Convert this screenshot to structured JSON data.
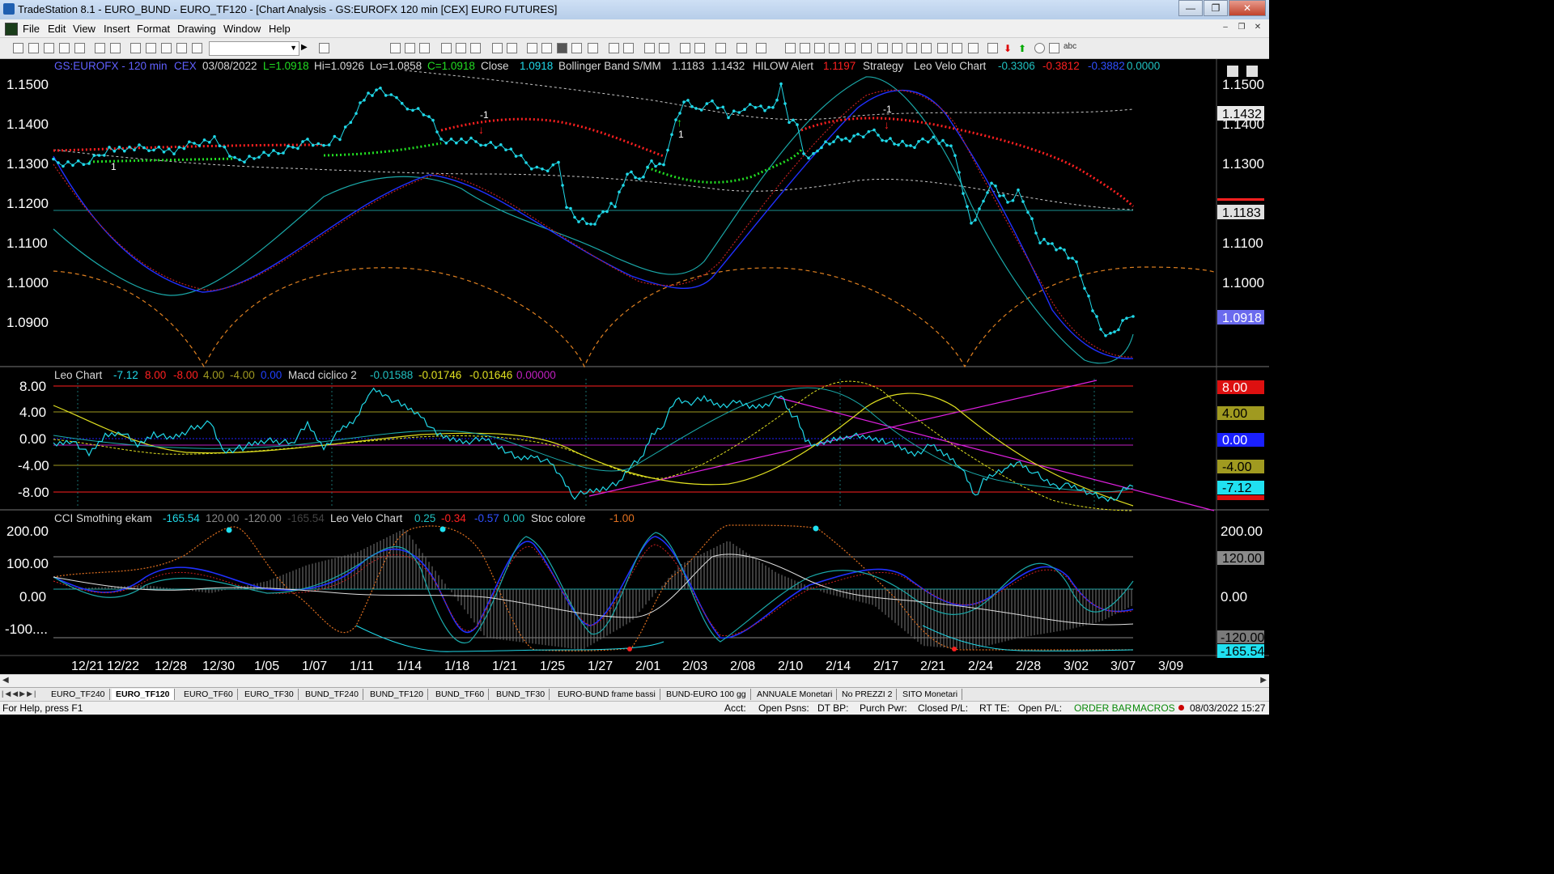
{
  "window": {
    "title": "TradeStation 8.1 - EURO_BUND - EURO_TF120 - [Chart Analysis - GS:EUROFX  120 min  [CEX] EURO FUTURES]",
    "minimize": "—",
    "restore": "❐",
    "close": "✕"
  },
  "menu": [
    "File",
    "Edit",
    "View",
    "Insert",
    "Format",
    "Drawing",
    "Window",
    "Help"
  ],
  "mdi_buttons": [
    "–",
    "❐",
    "✕"
  ],
  "toolbar": {
    "abc": "abc"
  },
  "header": {
    "symbol": "GS:EUROFX - 120 min",
    "exchange": "CEX",
    "date": "03/08/2022",
    "low": "L=1.0918",
    "high": "Hi=1.0926",
    "lo": "Lo=1.0858",
    "close": "C=1.0918",
    "close_label": "Close",
    "close_value": "1.0918",
    "bb_label": "Bollinger Band S/MM",
    "bb_v1": "1.1183",
    "bb_v2": "1.1432",
    "hilow_label": "HILOW Alert",
    "hilow_v": "1.1197",
    "strategy_label": "Strategy",
    "leovelo_label": "Leo Velo Chart",
    "lv1": "-0.3306",
    "lv2": "-0.3812",
    "lv3": "-0.3882",
    "lv4": "0.0000"
  },
  "panel2_header": {
    "label": "Leo Chart",
    "v1": "-7.12",
    "v2": "8.00",
    "v3": "-8.00",
    "v4": "4.00",
    "v5": "-4.00",
    "v6": "0.00",
    "macd_label": "Macd ciclico 2",
    "m1": "-0.01588",
    "m2": "-0.01746",
    "m3": "-0.01646",
    "m4": "0.00000"
  },
  "panel3_header": {
    "label": "CCI Smothing ekam",
    "v1": "-165.54",
    "v2": "120.00",
    "v3": "-120.00",
    "v4": "-165.54",
    "lv_label": "Leo Velo Chart",
    "l1": "0.25",
    "l2": "-0.34",
    "l3": "-0.57",
    "l4": "0.00",
    "stoc_label": "Stoc colore",
    "s1": "-1.00"
  },
  "price_axis": [
    "1.1500",
    "1.1400",
    "1.1300",
    "1.1200",
    "1.1100",
    "1.1000",
    "1.0900"
  ],
  "price_tags": {
    "t1": "1.1432",
    "t2": "1.1183",
    "t3": "1.0918"
  },
  "p2_axis": [
    "8.00",
    "4.00",
    "0.00",
    "-4.00",
    "-8.00"
  ],
  "p2_tags": {
    "t8": "8.00",
    "t4": "4.00",
    "t0": "0.00",
    "tm4": "-4.00",
    "tm7": "-7.12"
  },
  "p3_axis": [
    "200.00",
    "100.00",
    "0.00",
    "-100...."
  ],
  "p3_tags": {
    "t120": "120.00",
    "tm120": "-120.00",
    "tm165": "-165.54"
  },
  "markers": {
    "m1": "-1",
    "m2": "1",
    "m3": "-1",
    "m4": "1",
    "m5": "1"
  },
  "date_labels": [
    "12/21",
    "12/22",
    "12/28",
    "12/30",
    "1/05",
    "1/07",
    "1/11",
    "1/14",
    "1/18",
    "1/21",
    "1/25",
    "1/27",
    "2/01",
    "2/03",
    "2/08",
    "2/10",
    "2/14",
    "2/17",
    "2/21",
    "2/24",
    "2/28",
    "3/02",
    "3/07",
    "3/09"
  ],
  "tabs": [
    "EURO_TF240",
    "EURO_TF120",
    "EURO_TF60",
    "EURO_TF30",
    "BUND_TF240",
    "BUND_TF120",
    "BUND_TF60",
    "BUND_TF30",
    "EURO-BUND frame bassi",
    "BUND-EURO 100 gg",
    "ANNUALE Monetari",
    "No PREZZI 2",
    "SITO Monetari"
  ],
  "status": {
    "help": "For Help, press F1",
    "acct": "Acct:",
    "open_psns": "Open Psns:",
    "dtbp": "DT BP:",
    "purch": "Purch Pwr:",
    "closed": "Closed P/L:",
    "rtte": "RT TE:",
    "openpl": "Open P/L:",
    "orderbar": "ORDER BAR",
    "macros": "MACROS",
    "datetime": "08/03/2022 15:27"
  },
  "colors": {
    "background": "#000000",
    "price_dots": "#20d8e8",
    "bull_dots": "#22dd22",
    "bear_dots": "#ff2020",
    "bb_band": "#d0d0d0",
    "mavg_blue": "#2030ff",
    "mavg_red": "#d02020",
    "cycle_orange": "#e08020",
    "teal": "#1aa8a8"
  }
}
